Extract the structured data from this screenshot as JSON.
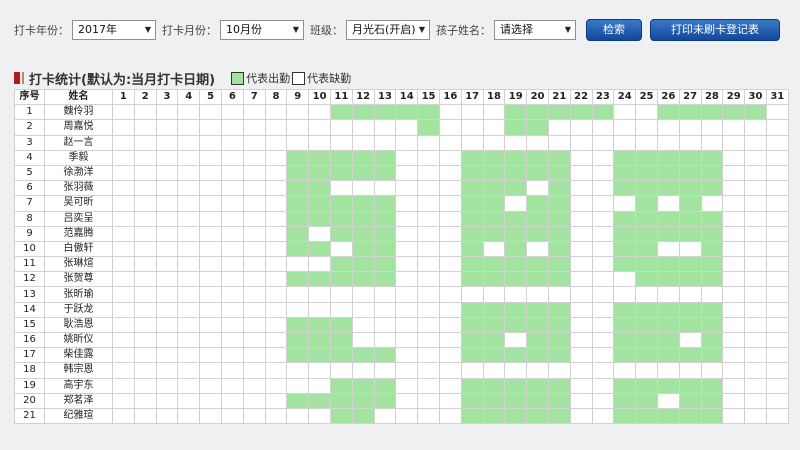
{
  "filters": {
    "year_label": "打卡年份：",
    "year_value": "2017年",
    "month_label": "打卡月份：",
    "month_value": "10月份",
    "class_label": "班级：",
    "class_value": "月光石(开启)",
    "child_label": "孩子姓名：",
    "child_value": "请选择",
    "search_button": "检索",
    "print_button": "打印未刷卡登记表"
  },
  "section": {
    "title": "打卡统计(默认为:当月打卡日期)",
    "legend_present": "代表出勤",
    "legend_absent": "代表缺勤"
  },
  "colors": {
    "present": "#a3e3a0",
    "absent": "#ffffff",
    "accent": "#1f5bb0"
  },
  "table": {
    "col_index": "序号",
    "col_name": "姓名",
    "days": [
      "1",
      "2",
      "3",
      "4",
      "5",
      "6",
      "7",
      "8",
      "9",
      "10",
      "11",
      "12",
      "13",
      "14",
      "15",
      "16",
      "17",
      "18",
      "19",
      "20",
      "21",
      "22",
      "23",
      "24",
      "25",
      "26",
      "27",
      "28",
      "29",
      "30",
      "31"
    ],
    "rows": [
      {
        "no": "1",
        "name": "魏伶羽",
        "att": "0000000000111110001111100111110011"
      },
      {
        "no": "2",
        "name": "周嘉悦",
        "att": "0000000000000010001100000000000010"
      },
      {
        "no": "3",
        "name": "赵一言",
        "att": "0000000000000000000000000000000000"
      },
      {
        "no": "4",
        "name": "季毅",
        "att": "0000000011111000111110011111000010"
      },
      {
        "no": "5",
        "name": "徐渤洋",
        "att": "0000000011111000111110011111000110"
      },
      {
        "no": "6",
        "name": "张羽薇",
        "att": "0000000011000000111010011111000000"
      },
      {
        "no": "7",
        "name": "吴可昕",
        "att": "0000000011111000110110001010000110"
      },
      {
        "no": "8",
        "name": "吕奕呈",
        "att": "0000000011111000111110011111000110"
      },
      {
        "no": "9",
        "name": "范嘉腾",
        "att": "0000000010111000111110011111000100"
      },
      {
        "no": "10",
        "name": "白傲轩",
        "att": "0000000011011000101010011001000100"
      },
      {
        "no": "11",
        "name": "张琳煊",
        "att": "0000000000111000111110011111000110"
      },
      {
        "no": "12",
        "name": "张贺尊",
        "att": "0000000011111000111110001111000110"
      },
      {
        "no": "13",
        "name": "张昕瑜",
        "att": "0000000000000000000000000000000000"
      },
      {
        "no": "14",
        "name": "于跃龙",
        "att": "0000000000000000111110011111000110"
      },
      {
        "no": "15",
        "name": "耿浩恩",
        "att": "0000000011100000111110011111000100"
      },
      {
        "no": "16",
        "name": "姚昕仪",
        "att": "0000000011100000110110011101000100"
      },
      {
        "no": "17",
        "name": "柴佳露",
        "att": "0000000011111000111110011111000110"
      },
      {
        "no": "18",
        "name": "韩宗恩",
        "att": "0000000000000000000000000000000000"
      },
      {
        "no": "19",
        "name": "高宇东",
        "att": "0000000000111000111110011111000110"
      },
      {
        "no": "20",
        "name": "郑茗泽",
        "att": "0000000011111000111110011011000100"
      },
      {
        "no": "21",
        "name": "纪雅瑄",
        "att": "0000000000110000111110011111000110"
      }
    ]
  }
}
